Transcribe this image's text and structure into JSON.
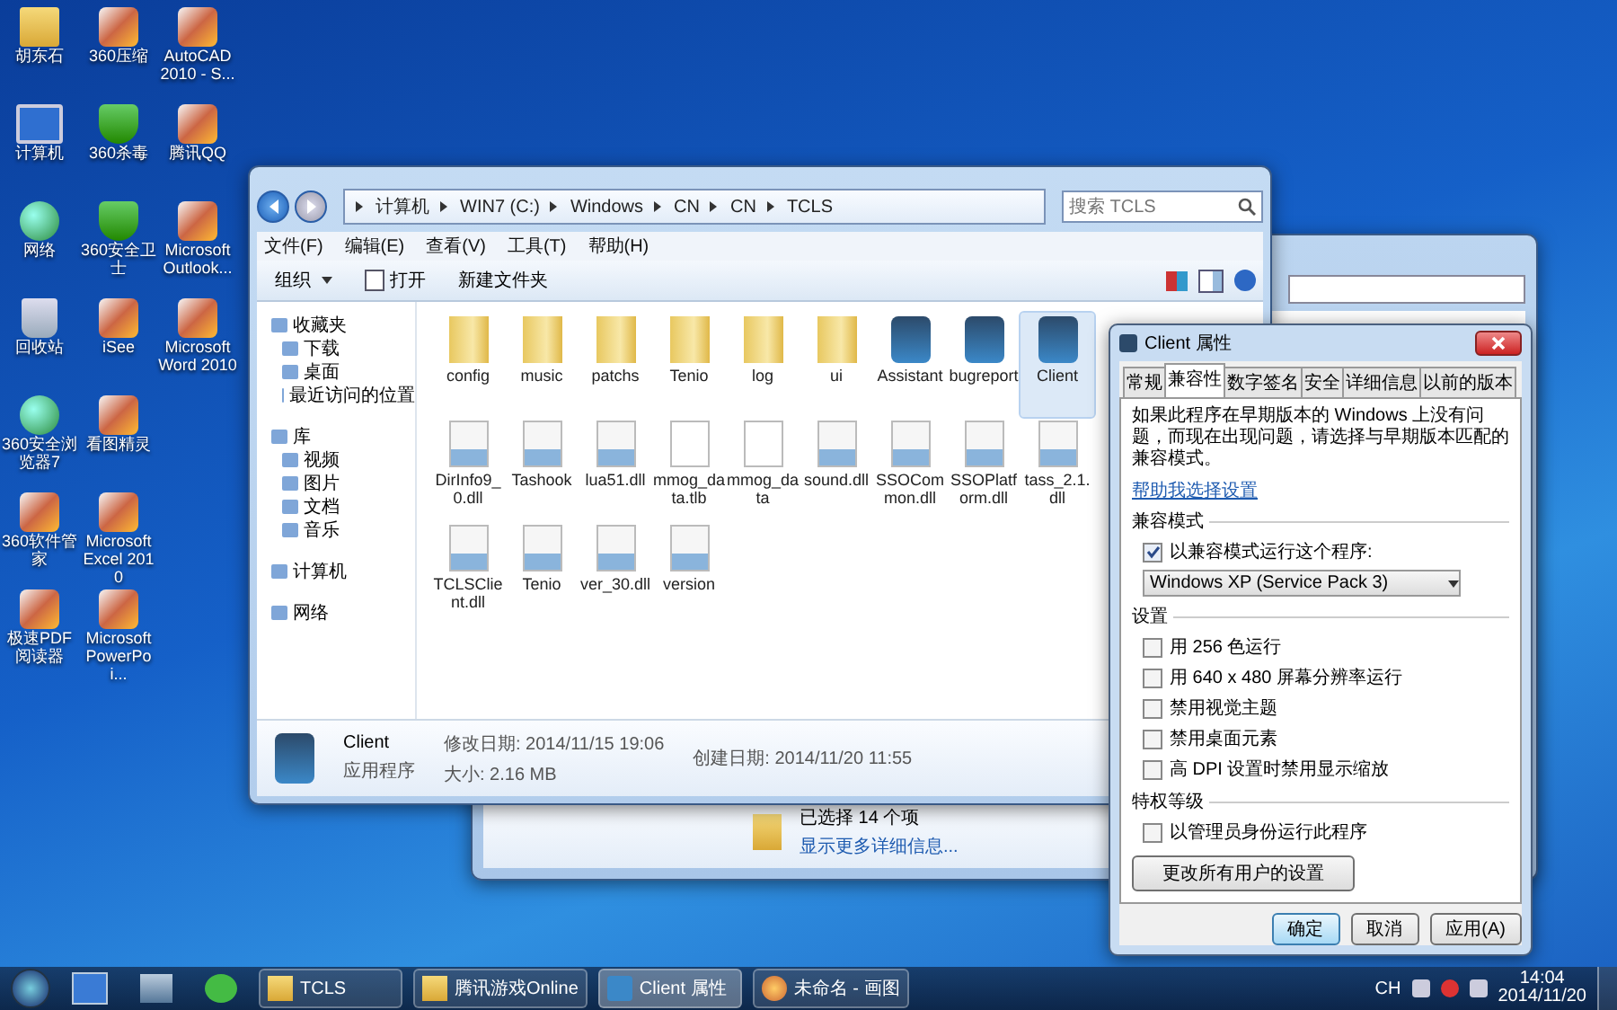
{
  "desktop_icons": [
    {
      "label": "胡东石",
      "kind": "folder"
    },
    {
      "label": "计算机",
      "kind": "monitor"
    },
    {
      "label": "网络",
      "kind": "globe"
    },
    {
      "label": "回收站",
      "kind": "bin"
    },
    {
      "label": "360安全浏览器7",
      "kind": "globe"
    },
    {
      "label": "360软件管家",
      "kind": "tile"
    },
    {
      "label": "极速PDF阅读器",
      "kind": "tile"
    },
    {
      "label": "360压缩",
      "kind": "tile"
    },
    {
      "label": "360杀毒",
      "kind": "shield"
    },
    {
      "label": "360安全卫士",
      "kind": "shield"
    },
    {
      "label": "iSee",
      "kind": "tile"
    },
    {
      "label": "看图精灵",
      "kind": "tile"
    },
    {
      "label": "Microsoft Excel 2010",
      "kind": "tile"
    },
    {
      "label": "Microsoft PowerPoi...",
      "kind": "tile"
    },
    {
      "label": "AutoCAD 2010 - S...",
      "kind": "tile"
    },
    {
      "label": "腾讯QQ",
      "kind": "tile"
    },
    {
      "label": "Microsoft Outlook...",
      "kind": "tile"
    },
    {
      "label": "Microsoft Word 2010",
      "kind": "tile"
    }
  ],
  "explorer": {
    "address": [
      "计算机",
      "WIN7 (C:)",
      "Windows",
      "CN",
      "CN",
      "TCLS"
    ],
    "search": {
      "placeholder": "搜索 TCLS"
    },
    "menu": [
      "文件(F)",
      "编辑(E)",
      "查看(V)",
      "工具(T)",
      "帮助(H)"
    ],
    "toolbar": [
      {
        "label": "组织",
        "kind": "menu"
      },
      {
        "label": "打开",
        "kind": "open"
      },
      {
        "label": "新建文件夹",
        "kind": "plain"
      }
    ],
    "sidebar": [
      {
        "label": "收藏夹",
        "children": [
          {
            "label": "下载"
          },
          {
            "label": "桌面"
          },
          {
            "label": "最近访问的位置"
          }
        ]
      },
      {
        "label": "库",
        "children": [
          {
            "label": "视频"
          },
          {
            "label": "图片"
          },
          {
            "label": "文档"
          },
          {
            "label": "音乐"
          }
        ]
      },
      {
        "label": "计算机"
      },
      {
        "label": "网络"
      }
    ],
    "files": [
      {
        "name": "config",
        "kind": "folder",
        "selected": false
      },
      {
        "name": "music",
        "kind": "folder",
        "selected": false
      },
      {
        "name": "patchs",
        "kind": "folder",
        "selected": false
      },
      {
        "name": "Tenio",
        "kind": "folder",
        "selected": false
      },
      {
        "name": "log",
        "kind": "folder",
        "selected": false
      },
      {
        "name": "ui",
        "kind": "folder",
        "selected": false
      },
      {
        "name": "Assistant",
        "kind": "app",
        "selected": false
      },
      {
        "name": "bugreport",
        "kind": "app",
        "selected": false
      },
      {
        "name": "Client",
        "kind": "app",
        "selected": true
      },
      {
        "name": "DirInfo9_0.dll",
        "kind": "dll",
        "selected": false
      },
      {
        "name": "Tashook",
        "kind": "dll",
        "selected": false
      },
      {
        "name": "lua51.dll",
        "kind": "dll",
        "selected": false
      },
      {
        "name": "mmog_data.tlb",
        "kind": "file",
        "selected": false
      },
      {
        "name": "mmog_data",
        "kind": "file",
        "selected": false
      },
      {
        "name": "sound.dll",
        "kind": "dll",
        "selected": false
      },
      {
        "name": "SSOCommon.dll",
        "kind": "dll",
        "selected": false
      },
      {
        "name": "SSOPlatform.dll",
        "kind": "dll",
        "selected": false
      },
      {
        "name": "tass_2.1.dll",
        "kind": "dll",
        "selected": false
      },
      {
        "name": "TCLSClient.dll",
        "kind": "dll",
        "selected": false
      },
      {
        "name": "Tenio",
        "kind": "dll",
        "selected": false
      },
      {
        "name": "ver_30.dll",
        "kind": "dll",
        "selected": false
      },
      {
        "name": "version",
        "kind": "dll",
        "selected": false
      }
    ],
    "details": {
      "name": "Client",
      "type": "应用程序",
      "modified": "修改日期: 2014/11/15 19:06",
      "size": "大小: 2.16 MB",
      "created": "创建日期: 2014/11/20 11:55"
    }
  },
  "back_window": {
    "status": "已选择 14 个项",
    "link": "显示更多详细信息..."
  },
  "dialog": {
    "title": "Client 属性",
    "tabs": [
      {
        "label": "常规",
        "selected": false
      },
      {
        "label": "兼容性",
        "selected": true
      },
      {
        "label": "数字签名",
        "selected": false
      },
      {
        "label": "安全",
        "selected": false
      },
      {
        "label": "详细信息",
        "selected": false
      },
      {
        "label": "以前的版本",
        "selected": false
      }
    ],
    "intro": "如果此程序在早期版本的 Windows 上没有问题，而现在出现问题，请选择与早期版本匹配的兼容模式。",
    "help_link": "帮助我选择设置",
    "groups": [
      {
        "title": "兼容模式",
        "options": [
          {
            "label": "以兼容模式运行这个程序:",
            "checked": true
          }
        ],
        "dropdown": "Windows XP (Service Pack 3)"
      },
      {
        "title": "设置",
        "options": [
          {
            "label": "用 256 色运行",
            "checked": false
          },
          {
            "label": "用 640 x 480 屏幕分辨率运行",
            "checked": false
          },
          {
            "label": "禁用视觉主题",
            "checked": false
          },
          {
            "label": "禁用桌面元素",
            "checked": false
          },
          {
            "label": "高 DPI 设置时禁用显示缩放",
            "checked": false
          }
        ]
      },
      {
        "title": "特权等级",
        "options": [
          {
            "label": "以管理员身份运行此程序",
            "checked": false
          }
        ]
      }
    ],
    "all_users_button": "更改所有用户的设置",
    "buttons": [
      {
        "label": "确定",
        "selected": true
      },
      {
        "label": "取消",
        "selected": false
      },
      {
        "label": "应用(A)",
        "selected": false
      }
    ]
  },
  "taskbar": {
    "tasks": [
      {
        "label": "TCLS",
        "kind": "folder",
        "selected": false
      },
      {
        "label": "腾讯游戏Online",
        "kind": "folder",
        "selected": false
      },
      {
        "label": "Client 属性",
        "kind": "app",
        "selected": true
      },
      {
        "label": "未命名 - 画图",
        "kind": "paint",
        "selected": false
      }
    ],
    "language": "CH",
    "time": "14:04",
    "date": "2014/11/20"
  }
}
